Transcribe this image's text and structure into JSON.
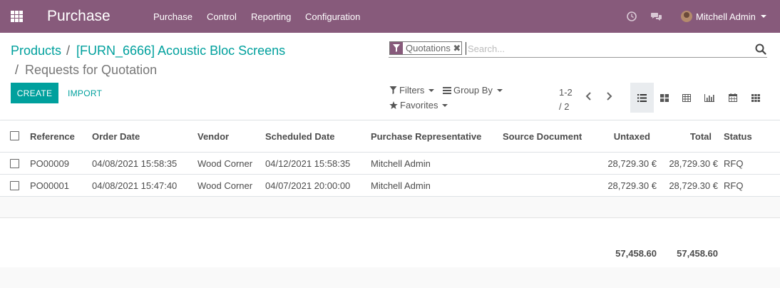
{
  "navbar": {
    "app_name": "Purchase",
    "menu": [
      "Purchase",
      "Control",
      "Reporting",
      "Configuration"
    ],
    "user_name": "Mitchell Admin",
    "accent_color": "#875a7b"
  },
  "breadcrumb": {
    "items": [
      "Products",
      "[FURN_6666] Acoustic Bloc Screens"
    ],
    "current": "Requests for Quotation",
    "separator": "/"
  },
  "search": {
    "facet_label": "Quotations",
    "facet_remove": "✖",
    "placeholder": "Search..."
  },
  "actions": {
    "create_label": "CREATE",
    "import_label": "IMPORT",
    "primary_color": "#00a09d"
  },
  "filters": {
    "filters_label": "Filters",
    "group_by_label": "Group By",
    "favorites_label": "Favorites"
  },
  "pager": {
    "range": "1-2",
    "total": "/ 2"
  },
  "views": [
    "list-view-icon",
    "kanban-view-icon",
    "pivot-view-icon",
    "graph-view-icon",
    "calendar-view-icon",
    "activity-view-icon"
  ],
  "table": {
    "columns": [
      "Reference",
      "Order Date",
      "Vendor",
      "Scheduled Date",
      "Purchase Representative",
      "Source Document",
      "Untaxed",
      "Total",
      "Status"
    ],
    "rows": [
      {
        "reference": "PO00009",
        "order_date": "04/08/2021 15:58:35",
        "vendor": "Wood Corner",
        "scheduled_date": "04/12/2021 15:58:35",
        "representative": "Mitchell Admin",
        "source": "",
        "untaxed": "28,729.30 €",
        "total": "28,729.30 €",
        "status": "RFQ"
      },
      {
        "reference": "PO00001",
        "order_date": "04/08/2021 15:47:40",
        "vendor": "Wood Corner",
        "scheduled_date": "04/07/2021 20:00:00",
        "representative": "Mitchell Admin",
        "source": "",
        "untaxed": "28,729.30 €",
        "total": "28,729.30 €",
        "status": "RFQ"
      }
    ],
    "totals": {
      "untaxed": "57,458.60",
      "total": "57,458.60"
    }
  }
}
